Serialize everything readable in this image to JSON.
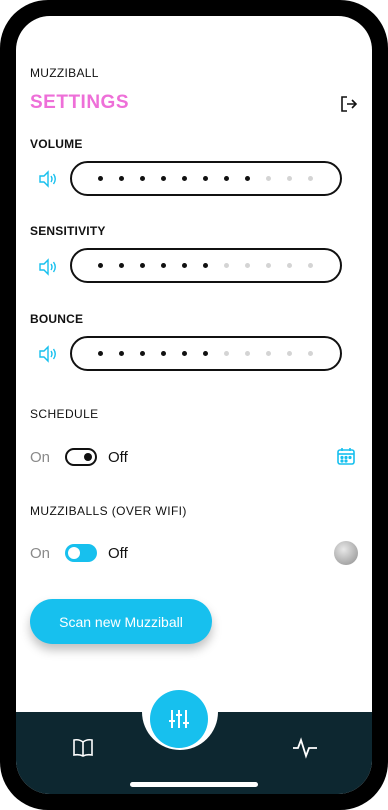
{
  "header": {
    "app_name": "MUZZIBALL",
    "title": "SETTINGS"
  },
  "volume": {
    "label": "VOLUME",
    "level": 8,
    "steps": 11
  },
  "sensitivity": {
    "label": "SENSITIVITY",
    "level": 6,
    "steps": 11
  },
  "bounce": {
    "label": "BOUNCE",
    "level": 6,
    "steps": 11
  },
  "schedule": {
    "label": "SCHEDULE",
    "on_label": "On",
    "off_label": "Off",
    "state": "off"
  },
  "muzziballs": {
    "label": "MUZZIBALLS (OVER WIFI)",
    "on_label": "On",
    "off_label": "Off",
    "state": "off"
  },
  "scan_button": {
    "label": "Scan new Muzziball"
  },
  "colors": {
    "accent": "#17c0ee",
    "title": "#ee6fd8",
    "nav": "#0d2730"
  },
  "nav": {
    "items": [
      "book-icon",
      "sliders-icon",
      "activity-icon"
    ],
    "active": "sliders-icon"
  }
}
